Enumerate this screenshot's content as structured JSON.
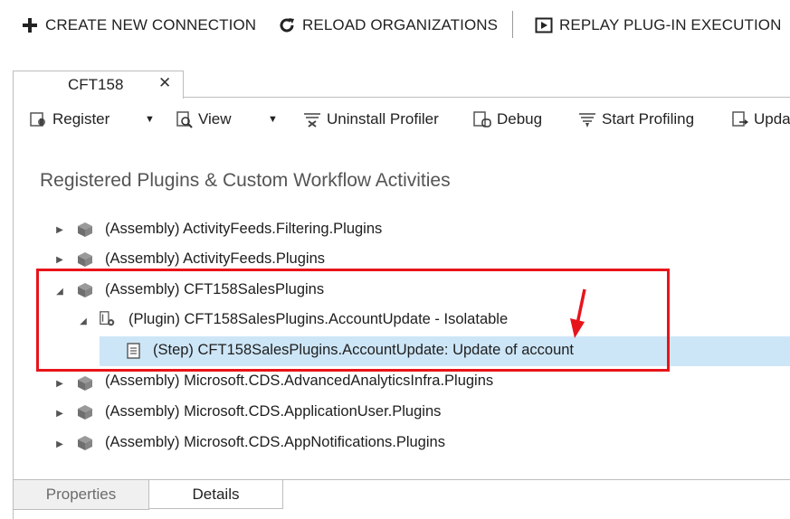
{
  "top_toolbar": {
    "create_connection": "CREATE NEW CONNECTION",
    "reload_organizations": "RELOAD ORGANIZATIONS",
    "replay_execution": "REPLAY PLUG-IN EXECUTION"
  },
  "document_tab": {
    "label": "CFT158",
    "close": "✕"
  },
  "toolbar": {
    "register": "Register",
    "view": "View",
    "uninstall_profiler": "Uninstall Profiler",
    "debug": "Debug",
    "start_profiling": "Start Profiling",
    "update": "Upda"
  },
  "section_title": "Registered Plugins & Custom Workflow Activities",
  "tree": {
    "rows": [
      {
        "label": "(Assembly) ActivityFeeds.Filtering.Plugins"
      },
      {
        "label": "(Assembly) ActivityFeeds.Plugins"
      },
      {
        "label": "(Assembly) CFT158SalesPlugins"
      },
      {
        "label": "(Plugin) CFT158SalesPlugins.AccountUpdate - Isolatable"
      },
      {
        "label": "(Step) CFT158SalesPlugins.AccountUpdate: Update of account"
      },
      {
        "label": "(Assembly) Microsoft.CDS.AdvancedAnalyticsInfra.Plugins"
      },
      {
        "label": "(Assembly) Microsoft.CDS.ApplicationUser.Plugins"
      },
      {
        "label": "(Assembly) Microsoft.CDS.AppNotifications.Plugins"
      }
    ]
  },
  "bottom_tabs": {
    "properties": "Properties",
    "details": "Details"
  },
  "colors": {
    "highlight": "#e8141b",
    "selection": "#cde6f7"
  }
}
